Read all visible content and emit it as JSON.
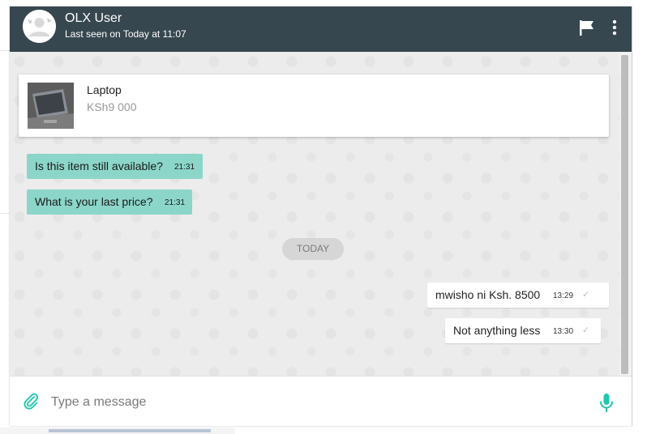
{
  "header": {
    "user_name": "OLX User",
    "last_seen": "Last seen on Today at 11:07"
  },
  "product": {
    "title": "Laptop",
    "price": "KSh9 000"
  },
  "messages": [
    {
      "direction": "incoming",
      "text": "Is this item still available?",
      "time": "21:31"
    },
    {
      "direction": "incoming",
      "text": "What is your last price?",
      "time": "21:31"
    },
    {
      "direction": "outgoing",
      "text": "mwisho ni Ksh. 8500",
      "time": "13:29",
      "status": "sent"
    },
    {
      "direction": "outgoing",
      "text": "Not anything less",
      "time": "13:30",
      "status": "sent"
    }
  ],
  "day_separator": "TODAY",
  "composer": {
    "placeholder": "Type a message",
    "value": ""
  },
  "icons": {
    "flag": "flag-icon",
    "menu": "more-vert-icon",
    "attach": "paperclip-icon",
    "mic": "microphone-icon"
  },
  "colors": {
    "header_bg": "#37474f",
    "incoming_bubble": "#8bd6c9",
    "accent": "#23c6b0"
  }
}
